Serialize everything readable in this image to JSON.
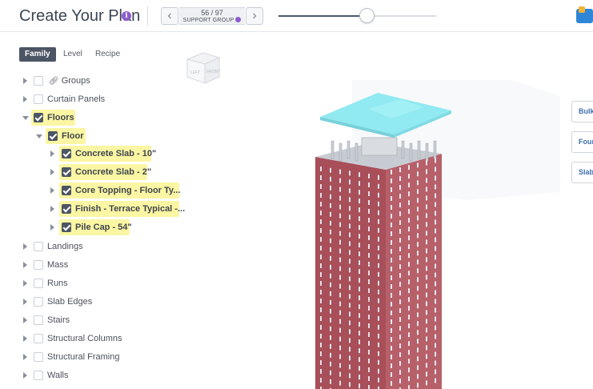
{
  "header": {
    "title": "Create Your Plan",
    "info_glyph": "i",
    "prev_glyph": "‹",
    "next_glyph": "›",
    "counter": "56 / 97",
    "counter_label": "SUPPORT GROUP"
  },
  "slider": {
    "value_fraction": 0.56
  },
  "tabs": [
    {
      "label": "Family",
      "active": true
    },
    {
      "label": "Level",
      "active": false
    },
    {
      "label": "Recipe",
      "active": false
    }
  ],
  "viewcube": {
    "left": "LEFT",
    "front": "FRONT"
  },
  "tree": {
    "groups": "Groups",
    "curtain_panels": "Curtain Panels",
    "floors": "Floors",
    "floor": "Floor",
    "concrete_slab_10": "Concrete Slab - 10\"",
    "concrete_slab_2": "Concrete Slab - 2\"",
    "core_topping": "Core Topping - Floor Ty...",
    "finish_terrace": "Finish - Terrace Typical -...",
    "pile_cap": "Pile Cap - 54\"",
    "landings": "Landings",
    "mass": "Mass",
    "runs": "Runs",
    "slab_edges": "Slab Edges",
    "stairs": "Stairs",
    "structural_columns": "Structural Columns",
    "structural_framing": "Structural Framing",
    "walls": "Walls"
  },
  "side_buttons": [
    "Bulk",
    "Foun",
    "Slab"
  ],
  "colors": {
    "accent": "#4c5563",
    "highlight": "#fbf6a3",
    "info": "#8b5bd1",
    "building": "#b2525c",
    "slab": "#7fe6ef"
  }
}
